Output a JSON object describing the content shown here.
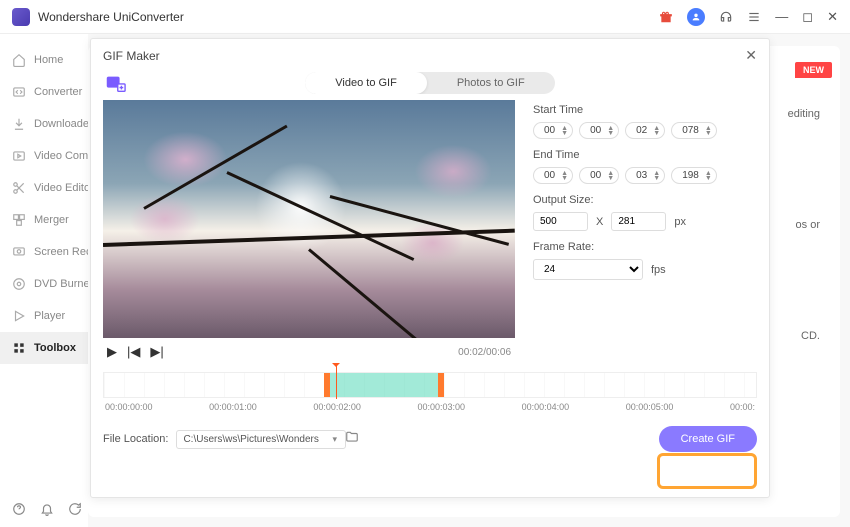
{
  "app": {
    "name": "Wondershare UniConverter"
  },
  "titlebar_icons": {
    "gift": "gift-icon",
    "avatar": "user-avatar",
    "headset": "support-icon",
    "menu": "menu-icon"
  },
  "sidebar": {
    "items": [
      {
        "label": "Home",
        "icon": "home-icon"
      },
      {
        "label": "Converter",
        "icon": "converter-icon"
      },
      {
        "label": "Downloader",
        "icon": "download-icon"
      },
      {
        "label": "Video Compressor",
        "icon": "compress-icon"
      },
      {
        "label": "Video Editor",
        "icon": "scissors-icon"
      },
      {
        "label": "Merger",
        "icon": "merger-icon"
      },
      {
        "label": "Screen Recorder",
        "icon": "record-icon"
      },
      {
        "label": "DVD Burner",
        "icon": "dvd-icon"
      },
      {
        "label": "Player",
        "icon": "player-icon"
      },
      {
        "label": "Toolbox",
        "icon": "toolbox-icon"
      }
    ]
  },
  "bg": {
    "new_badge": "NEW",
    "text1": "editing",
    "text2": "os or",
    "text3": "CD."
  },
  "modal": {
    "title": "GIF Maker",
    "tabs": {
      "video": "Video to GIF",
      "photos": "Photos to GIF"
    },
    "start_label": "Start Time",
    "end_label": "End Time",
    "start": {
      "h": "00",
      "m": "00",
      "s": "02",
      "ms": "078"
    },
    "end": {
      "h": "00",
      "m": "00",
      "s": "03",
      "ms": "198"
    },
    "output_label": "Output Size:",
    "output": {
      "w": "500",
      "h": "281",
      "x": "X",
      "unit": "px"
    },
    "fr_label": "Frame Rate:",
    "fr_value": "24",
    "fr_unit": "fps",
    "playtime": "00:02/00:06",
    "ticks": [
      "00:00:00:00",
      "00:00:01:00",
      "00:00:02:00",
      "00:00:03:00",
      "00:00:04:00",
      "00:00:05:00",
      "00:00:"
    ],
    "file_label": "File Location:",
    "file_path": "C:\\Users\\ws\\Pictures\\Wonders",
    "create_label": "Create GIF"
  }
}
